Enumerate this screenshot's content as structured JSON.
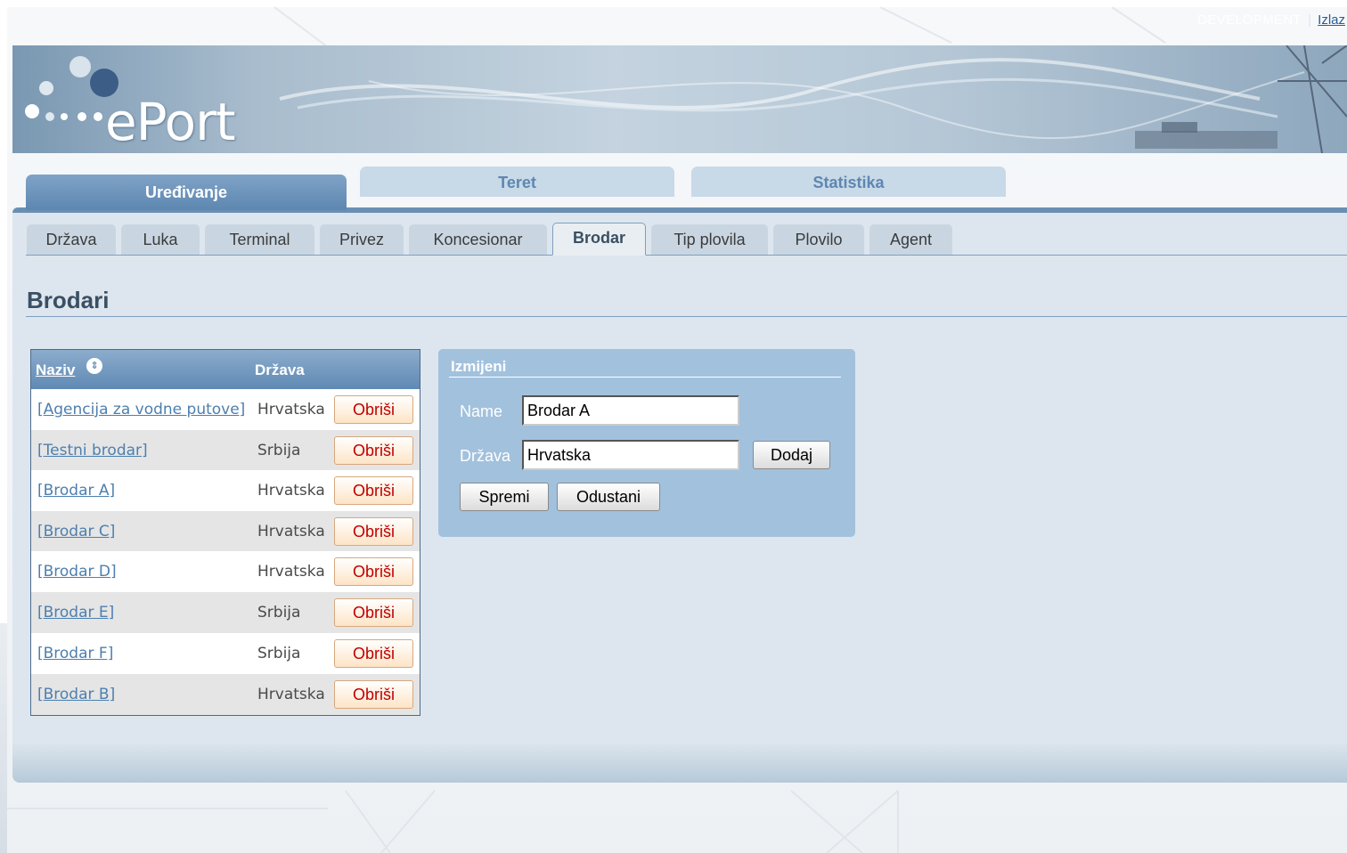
{
  "topbar": {
    "environment": "DEVELOPMENT",
    "separator": "|",
    "logout_link": "Izlaz"
  },
  "brand": {
    "logo_text": "ePort"
  },
  "main_tabs": [
    {
      "label": "Uređivanje",
      "active": true
    },
    {
      "label": "Teret",
      "active": false
    },
    {
      "label": "Statistika",
      "active": false
    }
  ],
  "sub_tabs": [
    {
      "label": "Država"
    },
    {
      "label": "Luka"
    },
    {
      "label": "Terminal"
    },
    {
      "label": "Privez"
    },
    {
      "label": "Koncesionar"
    },
    {
      "label": "Brodar",
      "active": true
    },
    {
      "label": "Tip plovila"
    },
    {
      "label": "Plovilo"
    },
    {
      "label": "Agent"
    }
  ],
  "page": {
    "title": "Brodari"
  },
  "grid": {
    "columns": {
      "naziv": "Naziv",
      "drzava": "Država"
    },
    "sort_icon": "sort-circle-icon",
    "delete_label": "Obriši",
    "rows": [
      {
        "naziv": "[Agencija za vodne putove]",
        "drzava": "Hrvatska"
      },
      {
        "naziv": "[Testni brodar]",
        "drzava": "Srbija"
      },
      {
        "naziv": "[Brodar A]",
        "drzava": "Hrvatska"
      },
      {
        "naziv": "[Brodar C]",
        "drzava": "Hrvatska"
      },
      {
        "naziv": "[Brodar D]",
        "drzava": "Hrvatska"
      },
      {
        "naziv": "[Brodar E]",
        "drzava": "Srbija"
      },
      {
        "naziv": "[Brodar F]",
        "drzava": "Srbija"
      },
      {
        "naziv": "[Brodar B]",
        "drzava": "Hrvatska"
      }
    ]
  },
  "edit_panel": {
    "title": "Izmijeni",
    "name_label": "Name",
    "name_value": "Brodar A",
    "drzava_label": "Država",
    "drzava_value": "Hrvatska",
    "add_button": "Dodaj",
    "save_button": "Spremi",
    "cancel_button": "Odustani"
  },
  "colors": {
    "accent_blue": "#5f89b4",
    "panel_blue": "#a2c1dd",
    "delete_red": "#c00000",
    "link_blue": "#4d7fae"
  }
}
